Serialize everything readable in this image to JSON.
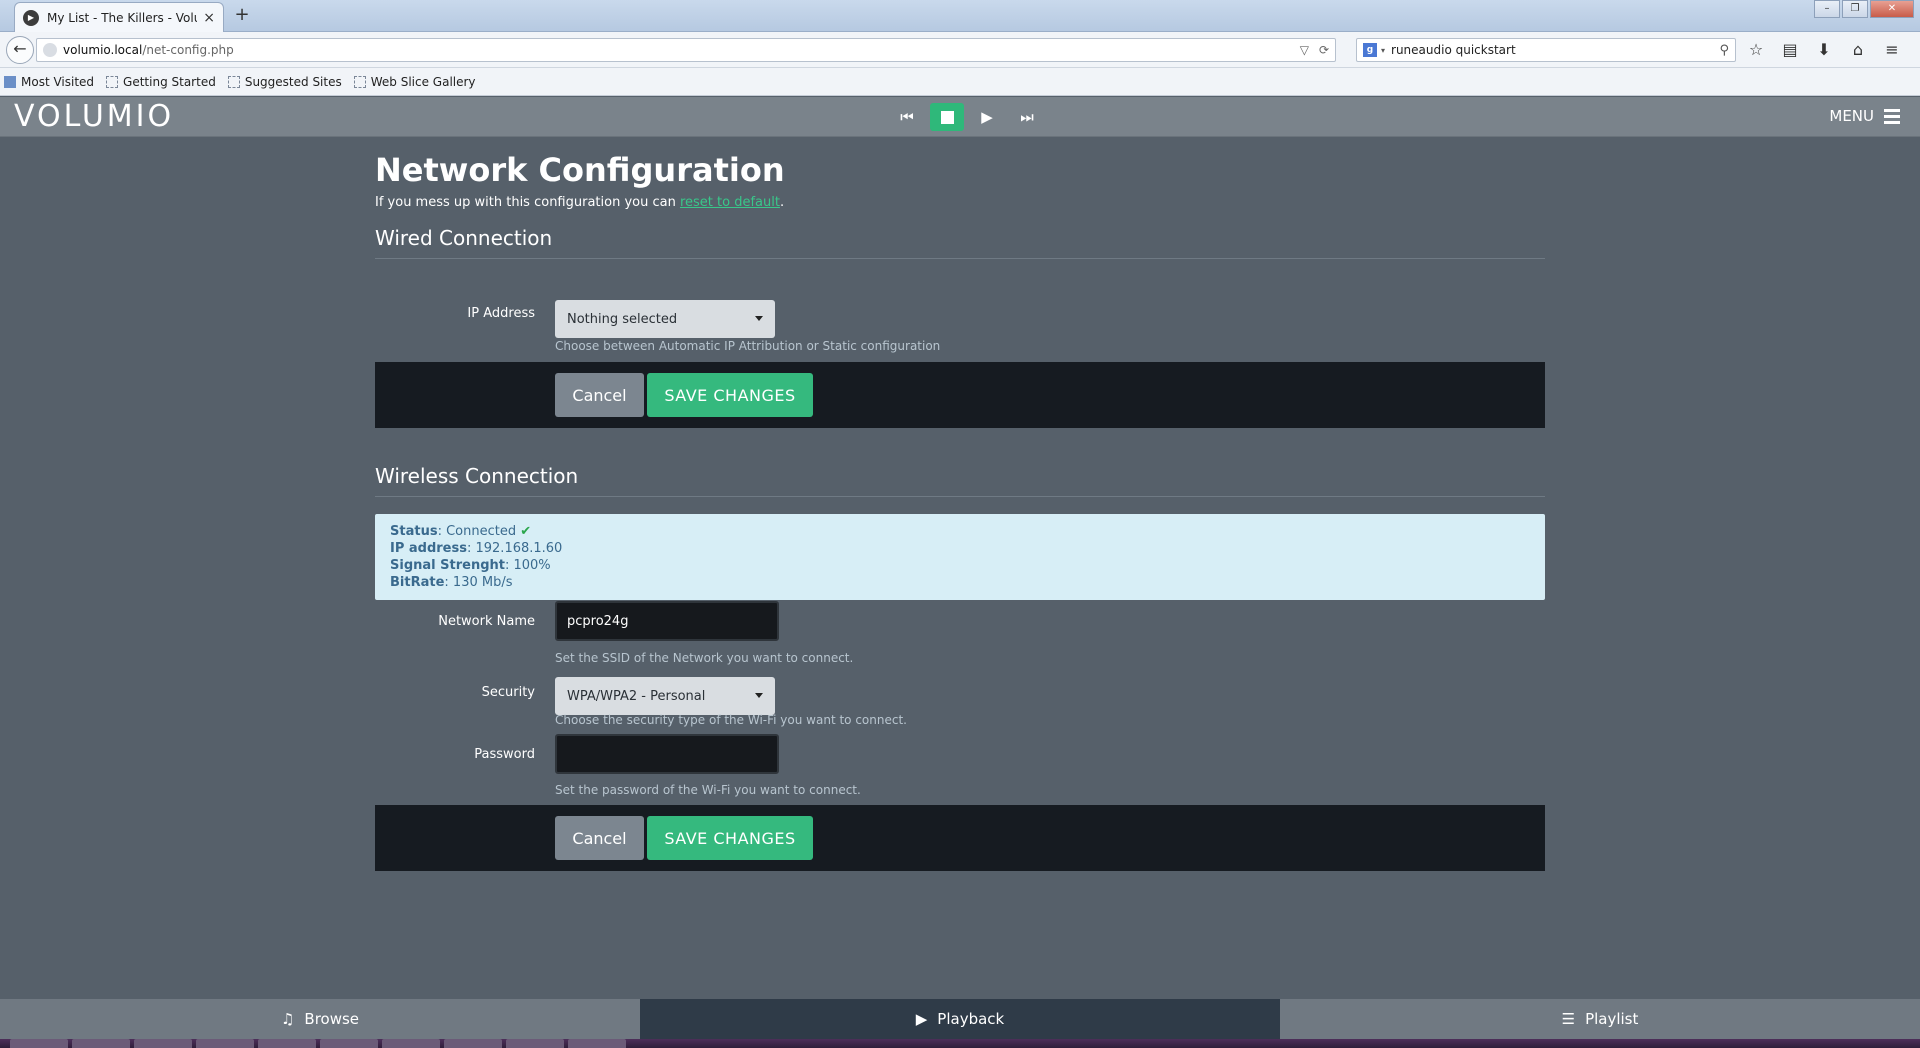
{
  "browser": {
    "tab_title": "My List - The Killers - Volu...",
    "tab_close": "×",
    "new_tab": "+",
    "back": "←",
    "url_domain": "volumio.local",
    "url_path": "/net-config.php",
    "url_dropdown": "▽",
    "url_reload": "⟳",
    "search_engine": "g",
    "search_engine_dropdown": "▾",
    "search_text": "runeaudio quickstart",
    "search_go": "⚲",
    "icons": [
      "star-icon",
      "reader-icon",
      "download-icon",
      "home-icon",
      "menu-icon"
    ],
    "icon_glyphs": [
      "☆",
      "▤",
      "⬇",
      "⌂",
      "≡"
    ],
    "window_controls": [
      "–",
      "❐",
      "✕"
    ],
    "bookmarks": [
      "Most Visited",
      "Getting Started",
      "Suggested Sites",
      "Web Slice Gallery"
    ]
  },
  "header": {
    "logo": "VOLUMIO",
    "transport_glyphs": {
      "prev": "⏮",
      "play": "▶",
      "next": "⏭"
    },
    "menu_label": "MENU",
    "accent_color": "#2fb87a"
  },
  "page": {
    "title": "Network Configuration",
    "intro_before": "If you mess up with this configuration you can ",
    "intro_link": "reset to default",
    "intro_after": "."
  },
  "wired": {
    "title": "Wired Connection",
    "ip_label": "IP Address",
    "ip_value": "Nothing selected",
    "ip_help": "Choose between Automatic IP Attribution or Static configuration",
    "cancel_label": "Cancel",
    "save_label": "SAVE CHANGES"
  },
  "wireless": {
    "title": "Wireless Connection",
    "status_label": "Status",
    "status_value": ": Connected ",
    "status_check": "✔",
    "ip_label": "IP address",
    "ip_value": ": 192.168.1.60",
    "signal_label": "Signal Strenght",
    "signal_value": ": 100%",
    "bitrate_label": "BitRate",
    "bitrate_value": ": 130 Mb/s",
    "network_name_label": "Network Name",
    "network_name_value": "pcpro24g",
    "network_name_help": "Set the SSID of the Network you want to connect.",
    "security_label": "Security",
    "security_value": "WPA/WPA2 - Personal",
    "security_help": "Choose the security type of the Wi-Fi you want to connect.",
    "password_label": "Password",
    "password_value": "",
    "password_help": "Set the password of the Wi-Fi you want to connect.",
    "cancel_label": "Cancel",
    "save_label": "SAVE CHANGES"
  },
  "bottom_tabs": [
    {
      "label": "Browse",
      "icon": "♫"
    },
    {
      "label": "Playback",
      "icon": "▶"
    },
    {
      "label": "Playlist",
      "icon": "☰"
    }
  ]
}
